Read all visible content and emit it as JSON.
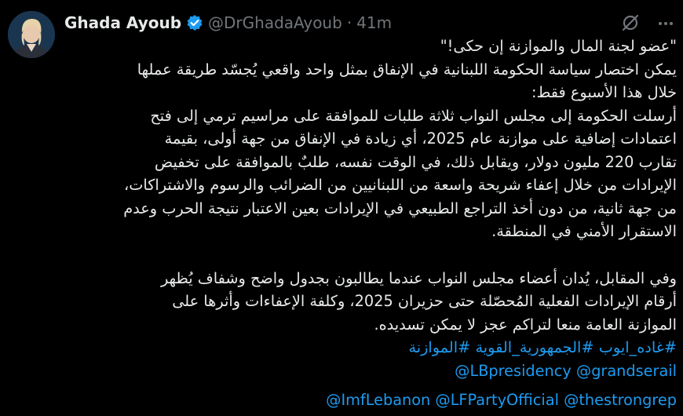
{
  "author": {
    "display_name": "Ghada Ayoub",
    "handle": "@DrGhadaAyoub",
    "separator": "·",
    "time": "41m",
    "verified_color": "#1d9bf0"
  },
  "icons": {
    "grok": "grok-icon",
    "more": "more-icon",
    "verified": "verified-badge-icon"
  },
  "tweet": {
    "quote_line": "\"عضو لجنة المال والموازنة إن حكى!\"",
    "para1_lines": [
      "يمكن اختصار سياسة الحكومة اللبنانية في الإنفاق بمثل واحد واقعي يُجسّد طريقة عملها",
      "خلال هذا الأسبوع فقط:",
      "أرسلت الحكومة إلى مجلس النواب ثلاثة طلبات للموافقة على مراسيم ترمي إلى فتح",
      "اعتمادات إضافية على موازنة عام 2025، أي زيادة في الإنفاق من جهة أولى، بقيمة",
      "تقارب 220 مليون دولار، ويقابل ذلك، في الوقت نفسه، طلبٌ بالموافقة على تخفيض",
      "الإيرادات من خلال إعفاء شريحة واسعة من اللبنانيين من الضرائب والرسوم والاشتراكات،",
      "من جهة ثانية، من دون أخذ التراجع الطبيعي في الإيرادات بعين الاعتبار نتيجة الحرب وعدم",
      "الاستقرار الأمني في المنطقة."
    ],
    "para2_lines": [
      "وفي المقابل، يُدان أعضاء مجلس النواب عندما يطالبون بجدول واضح وشفاف يُظهر",
      "أرقام الإيرادات الفعلية المُحصّلة حتى حزيران 2025، وكلفة الإعفاءات وأثرها على",
      "الموازنة العامة منعا لتراكم عجز لا يمكن تسديده."
    ],
    "hashtags": [
      "#غاده_ايوب",
      "#الجمهورية_القوية",
      "#الموازنة"
    ],
    "mentions_row1": [
      "@LBpresidency",
      "@grandserail"
    ],
    "mentions_row2": [
      "@ImfLebanon",
      "@LFPartyOfficial",
      "@thestrongrep"
    ]
  }
}
